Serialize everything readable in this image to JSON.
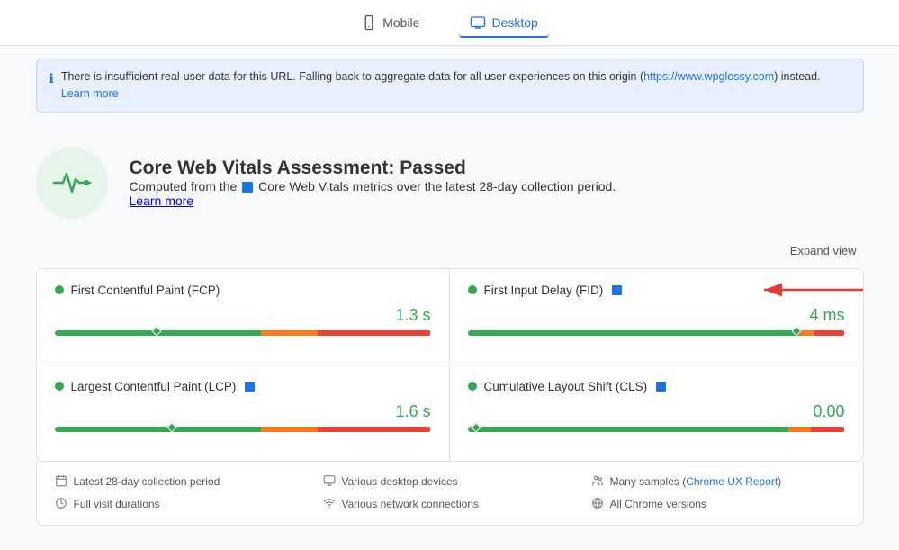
{
  "tabs": [
    {
      "id": "mobile",
      "label": "Mobile",
      "active": false
    },
    {
      "id": "desktop",
      "label": "Desktop",
      "active": true
    }
  ],
  "banner": {
    "text": "There is insufficient real-user data for this URL. Falling back to aggregate data for all user experiences on this origin (",
    "link_url": "https://www.wpglossy.com",
    "link_text": "https://www.wpglossy.com",
    "text_after": ") instead.",
    "learn_more_text": "Learn more",
    "learn_more_url": "#"
  },
  "assessment": {
    "title": "Core Web Vitals Assessment:",
    "status": "Passed",
    "description_prefix": "Computed from the",
    "description_suffix": "Core Web Vitals metrics over the latest 28-day collection period.",
    "learn_more": "Learn more"
  },
  "expand_view": "Expand view",
  "metrics": [
    {
      "id": "fcp",
      "title": "First Contentful Paint (FCP)",
      "value": "1.3 s",
      "has_badge": false,
      "bar_green_pct": 55,
      "bar_orange_pct": 15,
      "bar_red_pct": 30,
      "marker_pct": 26
    },
    {
      "id": "fid",
      "title": "First Input Delay (FID)",
      "value": "4 ms",
      "has_badge": true,
      "bar_green_pct": 87,
      "bar_orange_pct": 5,
      "bar_red_pct": 8,
      "marker_pct": 86
    },
    {
      "id": "lcp",
      "title": "Largest Contentful Paint (LCP)",
      "value": "1.6 s",
      "has_badge": true,
      "bar_green_pct": 55,
      "bar_orange_pct": 15,
      "bar_red_pct": 30,
      "marker_pct": 30
    },
    {
      "id": "cls",
      "title": "Cumulative Layout Shift (CLS)",
      "value": "0.00",
      "has_badge": true,
      "bar_green_pct": 85,
      "bar_orange_pct": 6,
      "bar_red_pct": 9,
      "marker_pct": 1
    }
  ],
  "footer": {
    "items": [
      {
        "icon": "calendar",
        "text": "Latest 28-day collection period"
      },
      {
        "icon": "monitor",
        "text": "Various desktop devices"
      },
      {
        "icon": "people",
        "text": "Many samples",
        "link_text": "Chrome UX Report",
        "link_url": "#"
      },
      {
        "icon": "clock",
        "text": "Full visit durations"
      },
      {
        "icon": "wifi",
        "text": "Various network connections"
      },
      {
        "icon": "globe",
        "text": "All Chrome versions"
      }
    ]
  }
}
